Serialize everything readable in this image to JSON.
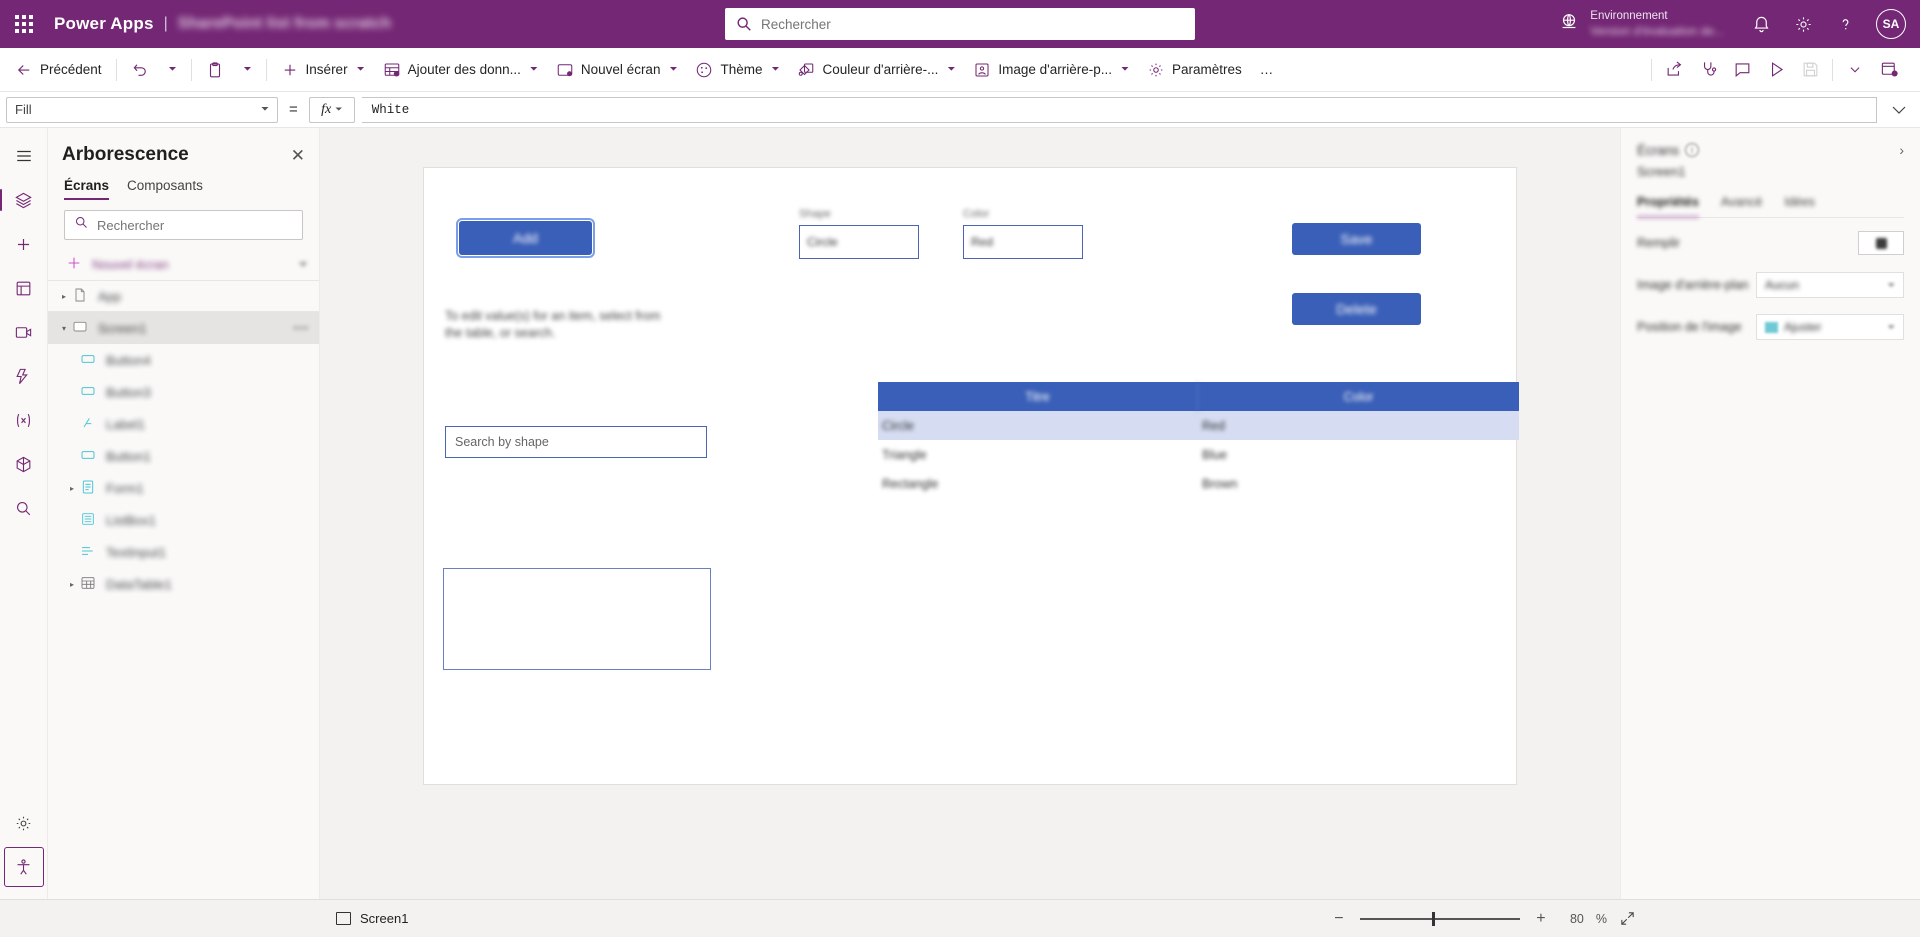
{
  "header": {
    "waffle_label": "app-launcher",
    "brand": "Power Apps",
    "separator": "|",
    "app_title": "SharePoint list from scratch",
    "search_placeholder": "Rechercher",
    "environment_label": "Environnement",
    "environment_value": "Version d'évaluation de...",
    "avatar_initials": "SA"
  },
  "commandbar": {
    "back": "Précédent",
    "insert": "Insérer",
    "add_data": "Ajouter des donn...",
    "new_screen": "Nouvel écran",
    "theme": "Thème",
    "background_color": "Couleur d'arrière-...",
    "background_image": "Image d'arrière-p...",
    "settings": "Paramètres",
    "overflow": "…",
    "right_icons": [
      "share-icon",
      "app-checker-icon",
      "comment-icon",
      "preview-icon",
      "save-icon",
      "chevron-down-icon",
      "publish-icon"
    ]
  },
  "formulabar": {
    "property": "Fill",
    "equals": "=",
    "fx_label": "fx",
    "formula": "White"
  },
  "rail": {
    "items": [
      {
        "name": "menu-icon",
        "label": "Menu"
      },
      {
        "name": "tree-view-icon",
        "label": "Arborescence"
      },
      {
        "name": "insert-icon",
        "label": "Insérer"
      },
      {
        "name": "data-icon",
        "label": "Données"
      },
      {
        "name": "media-icon",
        "label": "Média"
      },
      {
        "name": "power-automate-icon",
        "label": "Power Automate"
      },
      {
        "name": "variables-icon",
        "label": "Variables"
      },
      {
        "name": "components-icon",
        "label": "Composants"
      },
      {
        "name": "search-icon",
        "label": "Rechercher"
      }
    ],
    "bottom": [
      {
        "name": "settings-gear-icon",
        "label": "Paramètres"
      },
      {
        "name": "accessibility-icon",
        "label": "Accessibilité"
      }
    ]
  },
  "treepanel": {
    "title": "Arborescence",
    "close_label": "✕",
    "tabs": [
      {
        "label": "Écrans",
        "active": true
      },
      {
        "label": "Composants",
        "active": false
      }
    ],
    "search_placeholder": "Rechercher",
    "new_screen": "Nouvel écran",
    "items": [
      {
        "label": "App",
        "indent": 0,
        "twisty": "▸",
        "icon": "app-icon",
        "selected": false
      },
      {
        "label": "Screen1",
        "indent": 0,
        "twisty": "▾",
        "icon": "screen-icon",
        "selected": true,
        "more": "•••"
      },
      {
        "label": "Button4",
        "indent": 1,
        "twisty": "",
        "icon": "button-icon",
        "selected": false
      },
      {
        "label": "Button3",
        "indent": 1,
        "twisty": "",
        "icon": "button-icon",
        "selected": false
      },
      {
        "label": "Label1",
        "indent": 1,
        "twisty": "",
        "icon": "label-icon",
        "selected": false
      },
      {
        "label": "Button1",
        "indent": 1,
        "twisty": "",
        "icon": "button-icon",
        "selected": false
      },
      {
        "label": "Form1",
        "indent": 1,
        "twisty": "▸",
        "icon": "form-icon",
        "selected": false
      },
      {
        "label": "ListBox1",
        "indent": 1,
        "twisty": "",
        "icon": "listbox-icon",
        "selected": false
      },
      {
        "label": "TextInput1",
        "indent": 1,
        "twisty": "",
        "icon": "textinput-icon",
        "selected": false
      },
      {
        "label": "DataTable1",
        "indent": 1,
        "twisty": "▸",
        "icon": "datatable-icon",
        "selected": false
      }
    ]
  },
  "canvas": {
    "add_button": "Add",
    "save_button": "Save",
    "delete_button": "Delete",
    "shape_label": "Shape",
    "shape_value": "Circle",
    "color_label": "Color",
    "color_value": "Red",
    "instruction": "To edit value(s) for an item, select from the table, or search.",
    "search_placeholder": "Search by shape",
    "table": {
      "columns": [
        "Titre",
        "Color"
      ],
      "rows": [
        {
          "cells": [
            "Circle",
            "Red"
          ],
          "selected": true
        },
        {
          "cells": [
            "Triangle",
            "Blue"
          ],
          "selected": false
        },
        {
          "cells": [
            "Rectangle",
            "Brown"
          ],
          "selected": false
        }
      ]
    }
  },
  "propspanel": {
    "head_title": "Écrans",
    "info_glyph": "i",
    "collapse_glyph": "›",
    "subject": "Screen1",
    "tabs": [
      {
        "label": "Propriétés",
        "active": true
      },
      {
        "label": "Avancé",
        "active": false
      },
      {
        "label": "Idées",
        "active": false
      }
    ],
    "rows": [
      {
        "name": "Remplir",
        "control": "swatch",
        "value": ""
      },
      {
        "name": "Image d'arrière-plan",
        "control": "dropdown",
        "value": "Aucun"
      },
      {
        "name": "Position de l'image",
        "control": "dropdown-color",
        "value": "Ajuster"
      }
    ]
  },
  "statusbar": {
    "screen_name": "Screen1",
    "zoom_minus": "−",
    "zoom_plus": "+",
    "zoom_value": "80",
    "zoom_unit": "%",
    "fit_label": "fit-to-screen"
  },
  "colors": {
    "brand_purple": "#742774",
    "accent_blue": "#3a5fb8",
    "tab_underline": "#742774"
  }
}
